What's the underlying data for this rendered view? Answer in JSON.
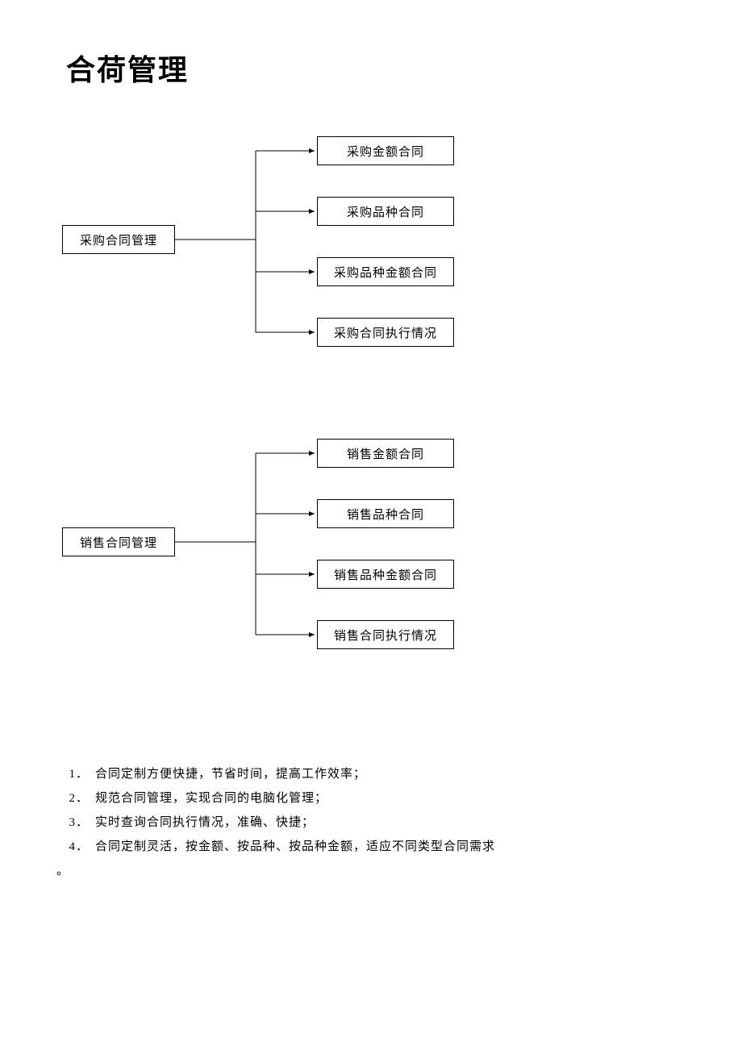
{
  "title": "合荷管理",
  "chart_data": [
    {
      "type": "tree",
      "root": "采购合同管理",
      "children": [
        "采购金额合同",
        "采购品种合同",
        "采购品种金额合同",
        "采购合同执行情况"
      ]
    },
    {
      "type": "tree",
      "root": "销售合同管理",
      "children": [
        "销售金额合同",
        "销售品种合同",
        "销售品种金额合同",
        "销售合同执行情况"
      ]
    }
  ],
  "tree1": {
    "root": "采购合同管理",
    "leaf0": "采购金额合同",
    "leaf1": "采购品种合同",
    "leaf2": "采购品种金额合同",
    "leaf3": "采购合同执行情况"
  },
  "tree2": {
    "root": "销售合同管理",
    "leaf0": "销售金额合同",
    "leaf1": "销售品种合同",
    "leaf2": "销售品种金额合同",
    "leaf3": "销售合同执行情况"
  },
  "bullets": {
    "n1": "1．",
    "t1": "合同定制方便快捷，节省时间，提高工作效率；",
    "n2": "2．",
    "t2": "规范合同管理，实现合同的电脑化管理；",
    "n3": "3．",
    "t3": "实时查询合同执行情况，准确、快捷；",
    "n4": "4．",
    "t4": "合同定制灵活，按金额、按品种、按品种金额，适应不同类型合同需求",
    "trail": "。"
  }
}
